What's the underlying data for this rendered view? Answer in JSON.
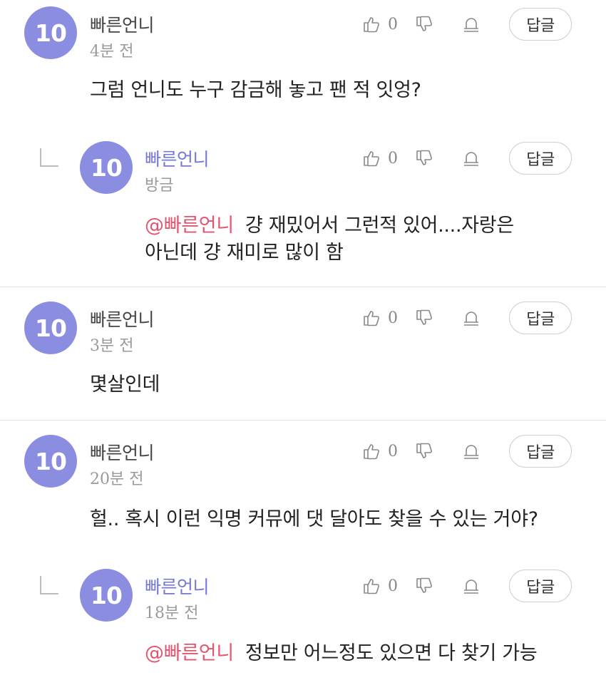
{
  "comments": [
    {
      "avatar_text": "10",
      "author": "빠른언니",
      "time": "4분 전",
      "like_count": "0",
      "reply_label": "답글",
      "body": "그럼 언니도 누구 감금해 놓고  팬 적 잇엉?"
    },
    {
      "avatar_text": "10",
      "author": "빠른언니",
      "time": "방금",
      "like_count": "0",
      "reply_label": "답글",
      "mention": "@빠른언니",
      "body_line1": "걍 재밌어서 그런적 있어....자랑은",
      "body_line2": "아닌데 걍 재미로 많이 함"
    },
    {
      "avatar_text": "10",
      "author": "빠른언니",
      "time": "3분 전",
      "like_count": "0",
      "reply_label": "답글",
      "body": "몇살인데"
    },
    {
      "avatar_text": "10",
      "author": "빠른언니",
      "time": "20분 전",
      "like_count": "0",
      "reply_label": "답글",
      "body": "헐.. 혹시 이런 익명 커뮤에 댓 달아도 찾을 수 있는 거야?"
    },
    {
      "avatar_text": "10",
      "author": "빠른언니",
      "time": "18분 전",
      "like_count": "0",
      "reply_label": "답글",
      "mention": "@빠른언니",
      "body": "정보만 어느정도 있으면 다 찾기 가능"
    }
  ],
  "icons": {
    "like": "thumbs-up-icon",
    "dislike": "thumbs-down-icon",
    "report": "bell-icon"
  },
  "colors": {
    "avatar": "#8b8ee0",
    "reply_author": "#7579d6",
    "mention": "#e0566f"
  }
}
